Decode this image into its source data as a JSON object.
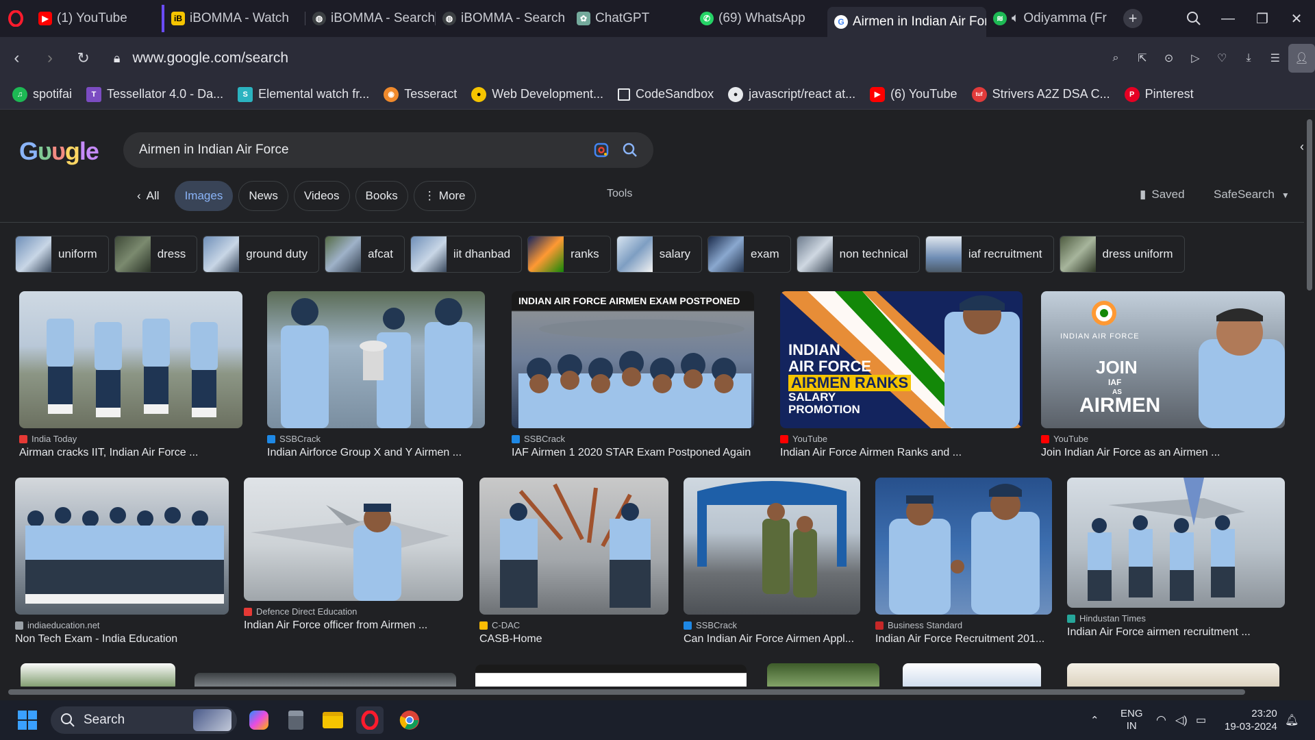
{
  "tabs": [
    {
      "label": "(1) YouTube",
      "icon": "youtube-icon",
      "color": "#ff0000"
    },
    {
      "label": "iBOMMA - Watch",
      "icon": "ibomma-icon",
      "color": "#f5c400"
    },
    {
      "label": "iBOMMA - Search",
      "icon": "globe-icon",
      "color": "#9aa0a6"
    },
    {
      "label": "iBOMMA - Search",
      "icon": "globe-icon",
      "color": "#9aa0a6"
    },
    {
      "label": "ChatGPT",
      "icon": "chatgpt-icon",
      "color": "#74aa9c"
    },
    {
      "label": "(69) WhatsApp",
      "icon": "whatsapp-icon",
      "color": "#25d366"
    },
    {
      "label": "Airmen in Indian Air Forc",
      "icon": "google-icon",
      "color": "#4285f4"
    },
    {
      "label": "Odiyamma (Fr",
      "icon": "spotify-icon",
      "color": "#1db954"
    }
  ],
  "address": {
    "url": "www.google.com/search"
  },
  "bookmarks": [
    {
      "label": "spotifai",
      "color": "#1db954",
      "glyph": "♫"
    },
    {
      "label": "Tessellator 4.0 - Da...",
      "color": "#7b4cc2",
      "glyph": "T"
    },
    {
      "label": "Elemental watch fr...",
      "color": "#2bb3c0",
      "glyph": "S"
    },
    {
      "label": "Tesseract",
      "color": "#f08a2c",
      "glyph": "◉"
    },
    {
      "label": "Web Development...",
      "color": "#f5c400",
      "glyph": "●"
    },
    {
      "label": "CodeSandbox",
      "color": "#202124",
      "glyph": "□"
    },
    {
      "label": "javascript/react at...",
      "color": "#e8eaed",
      "glyph": "●"
    },
    {
      "label": "(6) YouTube",
      "color": "#ff0000",
      "glyph": "▶"
    },
    {
      "label": "Strivers A2Z DSA C...",
      "color": "#e23b3b",
      "glyph": "tuf"
    },
    {
      "label": "Pinterest",
      "color": "#e60023",
      "glyph": "P"
    }
  ],
  "search": {
    "query": "Airmen in Indian Air Force"
  },
  "filters": {
    "back": "All",
    "items": [
      "Images",
      "News",
      "Videos",
      "Books",
      "More"
    ],
    "tools": "Tools",
    "saved": "Saved",
    "safesearch": "SafeSearch"
  },
  "refinements": [
    "uniform",
    "dress",
    "ground duty",
    "afcat",
    "iit dhanbad",
    "ranks",
    "salary",
    "exam",
    "non technical",
    "iaf recruitment",
    "dress uniform"
  ],
  "results": [
    {
      "source": "India Today",
      "title": "Airman cracks IIT, Indian Air Force ...",
      "fav": "#e53935"
    },
    {
      "source": "SSBCrack",
      "title": "Indian Airforce Group X and Y Airmen ...",
      "fav": "#1e88e5"
    },
    {
      "source": "SSBCrack",
      "title": "IAF Airmen 1 2020 STAR Exam Postponed Again",
      "fav": "#1e88e5",
      "overlay": "INDIAN AIR FORCE AIRMEN  EXAM POSTPONED"
    },
    {
      "source": "YouTube",
      "title": "Indian Air Force Airmen Ranks and ...",
      "fav": "#ff0000",
      "overlay_lines": [
        "INDIAN",
        "AIR FORCE",
        "AIRMEN RANKS",
        "SALARY",
        "PROMOTION"
      ]
    },
    {
      "source": "YouTube",
      "title": "Join Indian Air Force as an Airmen ...",
      "fav": "#ff0000",
      "overlay_lines": [
        "INDIAN AIR FORCE",
        "JOIN",
        "IAF",
        "AS",
        "AIRMEN"
      ]
    },
    {
      "source": "indiaeducation.net",
      "title": "Non Tech Exam - India Education",
      "fav": "#9aa0a6"
    },
    {
      "source": "Defence Direct Education",
      "title": "Indian Air Force officer from Airmen ...",
      "fav": "#e53935"
    },
    {
      "source": "C-DAC",
      "title": "CASB-Home",
      "fav": "#fbbc04"
    },
    {
      "source": "SSBCrack",
      "title": "Can Indian Air Force Airmen Appl...",
      "fav": "#1e88e5"
    },
    {
      "source": "Business Standard",
      "title": "Indian Air Force Recruitment 201...",
      "fav": "#c62828"
    },
    {
      "source": "Hindustan Times",
      "title": "Indian Air Force airmen recruitment ...",
      "fav": "#26a69a"
    }
  ],
  "taskbar": {
    "search": "Search",
    "lang": "ENG",
    "region": "IN",
    "time": "23:20",
    "date": "19-03-2024"
  }
}
